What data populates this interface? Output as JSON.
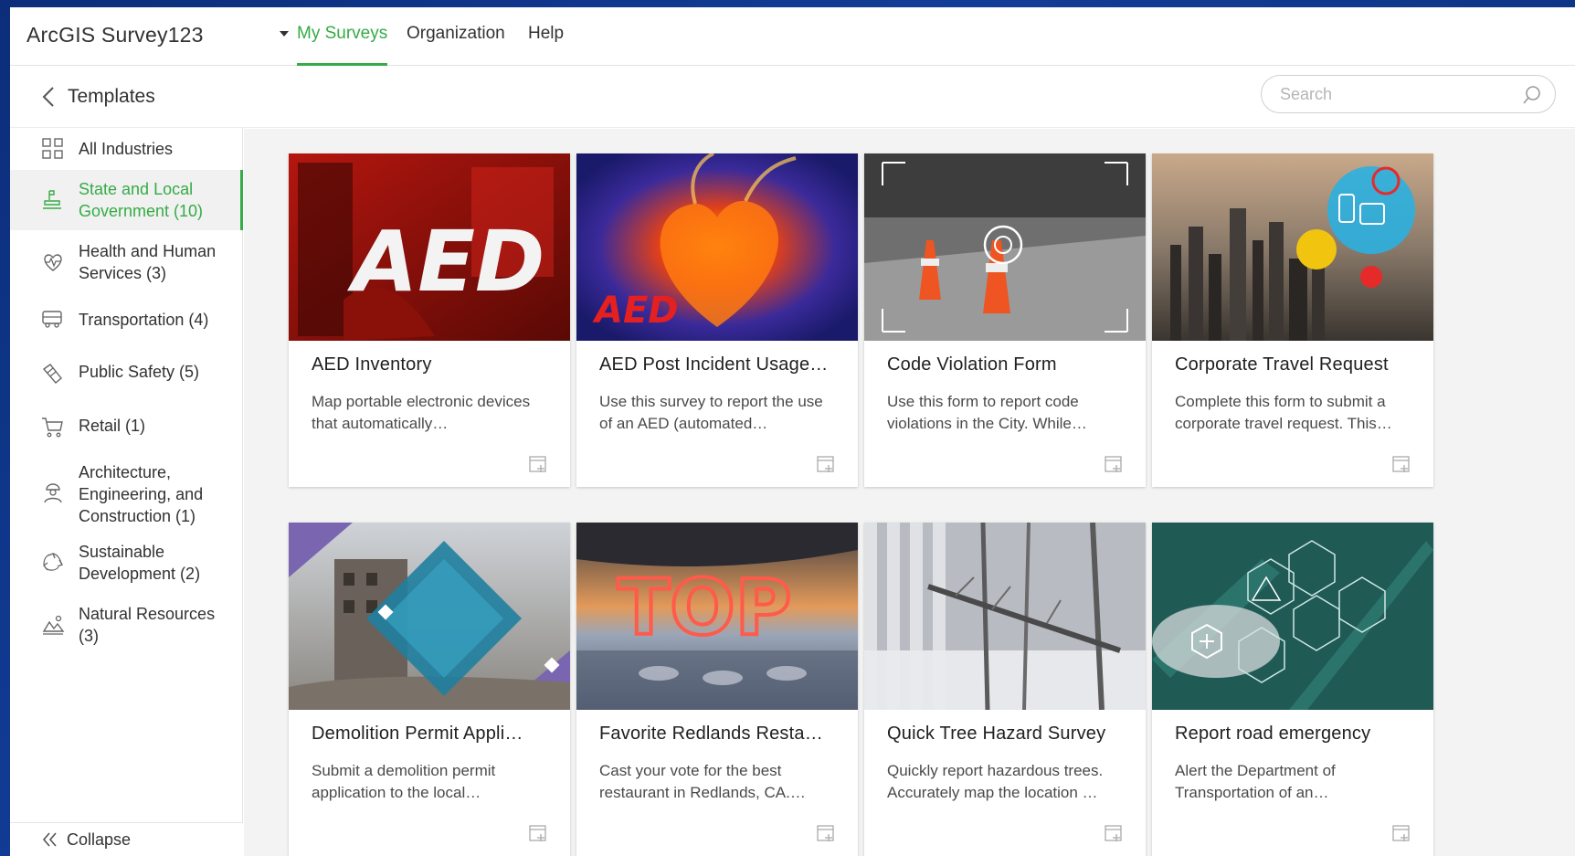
{
  "app": {
    "title": "ArcGIS Survey123"
  },
  "nav": {
    "tabs": [
      {
        "label": "My Surveys",
        "active": true
      },
      {
        "label": "Organization",
        "active": false
      },
      {
        "label": "Help",
        "active": false
      }
    ]
  },
  "header": {
    "title": "Templates",
    "search_placeholder": "Search"
  },
  "sidebar": {
    "items": [
      {
        "label": "All Industries",
        "icon": "grid-icon",
        "active": false
      },
      {
        "label": "State and Local Government (10)",
        "icon": "government-icon",
        "active": true
      },
      {
        "label": "Health and Human Services (3)",
        "icon": "heart-pulse-icon",
        "active": false
      },
      {
        "label": "Transportation (4)",
        "icon": "bus-icon",
        "active": false
      },
      {
        "label": "Public Safety (5)",
        "icon": "safety-icon",
        "active": false
      },
      {
        "label": "Retail (1)",
        "icon": "cart-icon",
        "active": false
      },
      {
        "label": "Architecture, Engineering, and Construction (1)",
        "icon": "worker-icon",
        "active": false
      },
      {
        "label": "Sustainable Development (2)",
        "icon": "recycle-icon",
        "active": false
      },
      {
        "label": "Natural Resources (3)",
        "icon": "nature-icon",
        "active": false
      }
    ],
    "collapse_label": "Collapse"
  },
  "cards": [
    {
      "title": "AED Inventory",
      "description": "Map portable electronic devices that automatically…",
      "image_text": "AED"
    },
    {
      "title": "AED Post Incident Usage…",
      "description": "Use this survey to report the use of an AED (automated…",
      "image_text": "AED"
    },
    {
      "title": "Code Violation Form",
      "description": "Use this form to report code violations in the City. While…"
    },
    {
      "title": "Corporate Travel Request",
      "description": "Complete this form to submit a corporate travel request. This…"
    },
    {
      "title": "Demolition Permit Appli…",
      "description": "Submit a demolition permit application to the local…"
    },
    {
      "title": "Favorite Redlands Resta…",
      "description": "Cast your vote for the best restaurant in Redlands, CA.…",
      "image_text": "TOP"
    },
    {
      "title": "Quick Tree Hazard Survey",
      "description": "Quickly report hazardous trees. Accurately map the location …"
    },
    {
      "title": "Report road emergency",
      "description": "Alert the Department of Transportation of an…"
    }
  ],
  "colors": {
    "accent": "#35ac46",
    "background": "#123d97"
  }
}
